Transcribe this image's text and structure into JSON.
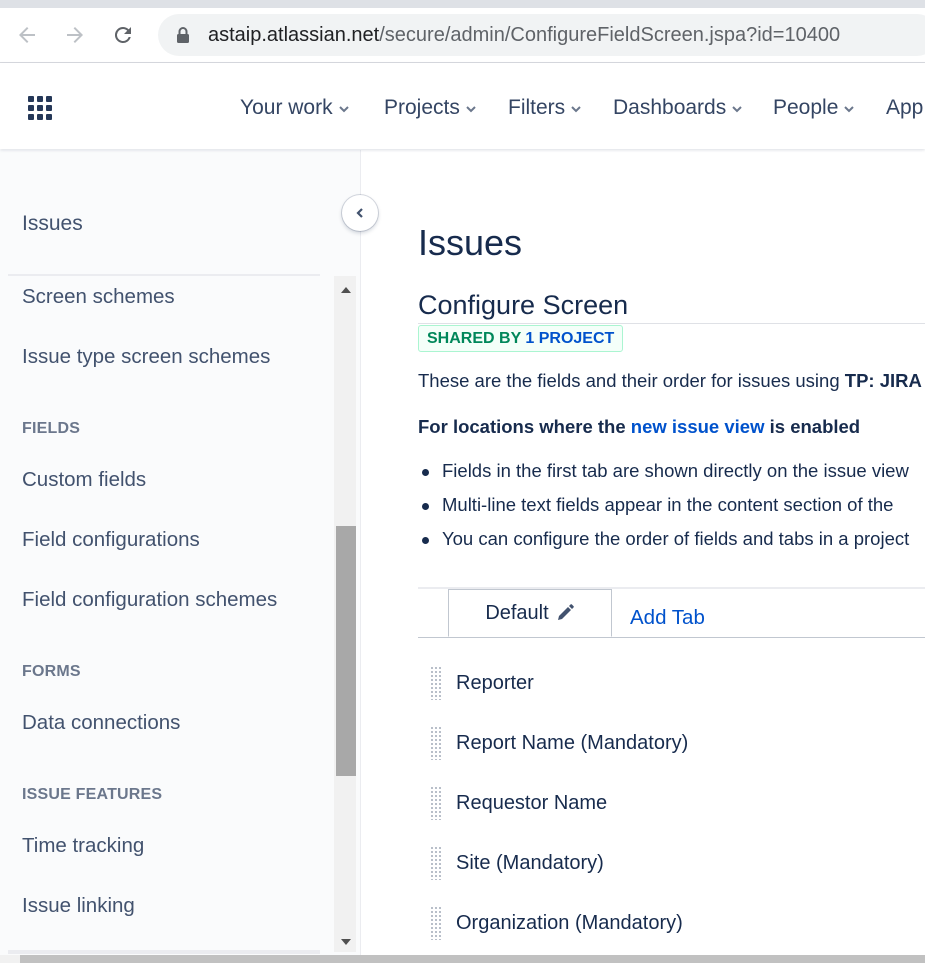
{
  "browser": {
    "url_host": "astaip.atlassian.net",
    "url_path": "/secure/admin/ConfigureFieldScreen.jspa?id=10400",
    "back_icon": "back-arrow-icon",
    "forward_icon": "forward-arrow-icon",
    "reload_icon": "reload-icon"
  },
  "header": {
    "menu": [
      {
        "label": "Your work"
      },
      {
        "label": "Projects"
      },
      {
        "label": "Filters"
      },
      {
        "label": "Dashboards"
      },
      {
        "label": "People"
      },
      {
        "label": "App"
      }
    ]
  },
  "sidebar": {
    "title": "Issues",
    "items": [
      {
        "label": "Screen schemes"
      },
      {
        "label": "Issue type screen schemes"
      }
    ],
    "sections": [
      {
        "heading": "FIELDS",
        "items": [
          "Custom fields",
          "Field configurations",
          "Field configuration schemes"
        ]
      },
      {
        "heading": "FORMS",
        "items": [
          "Data connections"
        ]
      },
      {
        "heading": "ISSUE FEATURES",
        "items": [
          "Time tracking",
          "Issue linking"
        ]
      }
    ]
  },
  "main": {
    "page_title": "Issues",
    "section_title": "Configure Screen",
    "badge": {
      "prefix": "SHARED BY ",
      "count": "1 PROJECT"
    },
    "description_prefix": "These are the fields and their order for issues using ",
    "description_bold": "TP: JIRA",
    "locations": {
      "prefix": "For locations where the ",
      "link": "new issue view",
      "suffix": " is enabled"
    },
    "bullets": [
      "Fields in the first tab are shown directly on the issue view",
      "Multi-line text fields appear in the content section of the",
      "You can configure the order of fields and tabs in a project"
    ],
    "tabs": {
      "default_label": "Default",
      "add_label": "Add Tab"
    },
    "fields": [
      "Reporter",
      "Report Name (Mandatory)",
      "Requestor Name",
      "Site (Mandatory)",
      "Organization (Mandatory)"
    ]
  },
  "colors": {
    "link": "#0052cc",
    "text": "#172b4d",
    "badge_green": "#00875a"
  }
}
